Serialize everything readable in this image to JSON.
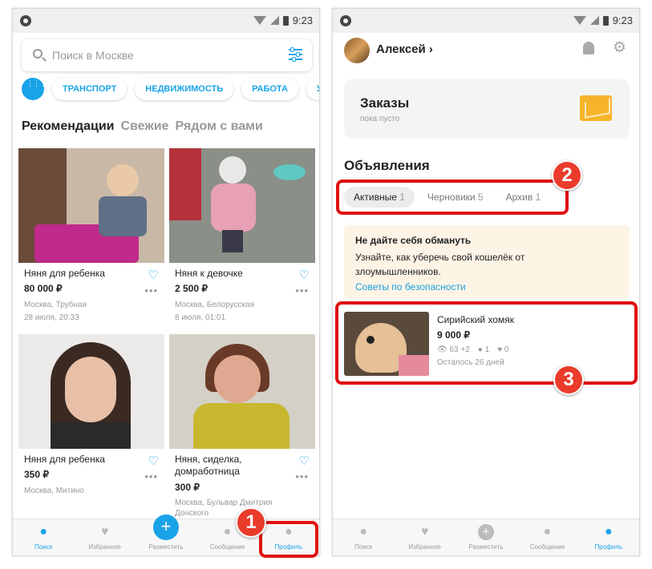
{
  "status_bar": {
    "time": "9:23"
  },
  "screen1": {
    "search": {
      "placeholder": "Поиск в Москве"
    },
    "categories": [
      "ТРАНСПОРТ",
      "НЕДВИЖИМОСТЬ",
      "РАБОТА",
      "УСЛУ"
    ],
    "tabs": [
      "Рекомендации",
      "Свежие",
      "Рядом с вами"
    ],
    "cards": [
      {
        "title": "Няня для ребенка",
        "price": "80 000 ₽",
        "location": "Москва, Трубная",
        "date": "28 июля, 20:33"
      },
      {
        "title": "Няня к девочке",
        "price": "2 500 ₽",
        "location": "Москва, Белорусская",
        "date": "8 июля, 01:01"
      },
      {
        "title": "Няня для ребенка",
        "price": "350 ₽",
        "location": "Москва, Митино",
        "date": ""
      },
      {
        "title": "Няня, сиделка, домработница",
        "price": "300 ₽",
        "location": "Москва, Бульвар Дмитрия Донского",
        "date": ""
      }
    ],
    "nav": [
      "Поиск",
      "Избранное",
      "Разместить",
      "Сообщения",
      "Профиль"
    ],
    "badge": "1"
  },
  "screen2": {
    "user_name": "Алексей",
    "orders": {
      "title": "Заказы",
      "subtitle": "пока пусто"
    },
    "section_title": "Объявления",
    "tabs": [
      {
        "label": "Активные",
        "count": "1"
      },
      {
        "label": "Черновики",
        "count": "5"
      },
      {
        "label": "Архив",
        "count": "1"
      }
    ],
    "warning": {
      "title": "Не дайте себя обмануть",
      "body": "Узнайте, как уберечь свой кошелёк от злоумышленников.",
      "link": "Советы по безопасности"
    },
    "ad": {
      "title": "Сирийский хомяк",
      "price": "9 000 ₽",
      "views": "63 +2",
      "contacts": "1",
      "favorites": "0",
      "remaining": "Осталось 26 дней"
    },
    "nav": [
      "Поиск",
      "Избранное",
      "Разместить",
      "Сообщения",
      "Профиль"
    ],
    "badge2": "2",
    "badge3": "3"
  },
  "colors": {
    "accent": "#1aa3e8",
    "highlight": "#e01010",
    "warning_bg": "#fdf4e6"
  }
}
